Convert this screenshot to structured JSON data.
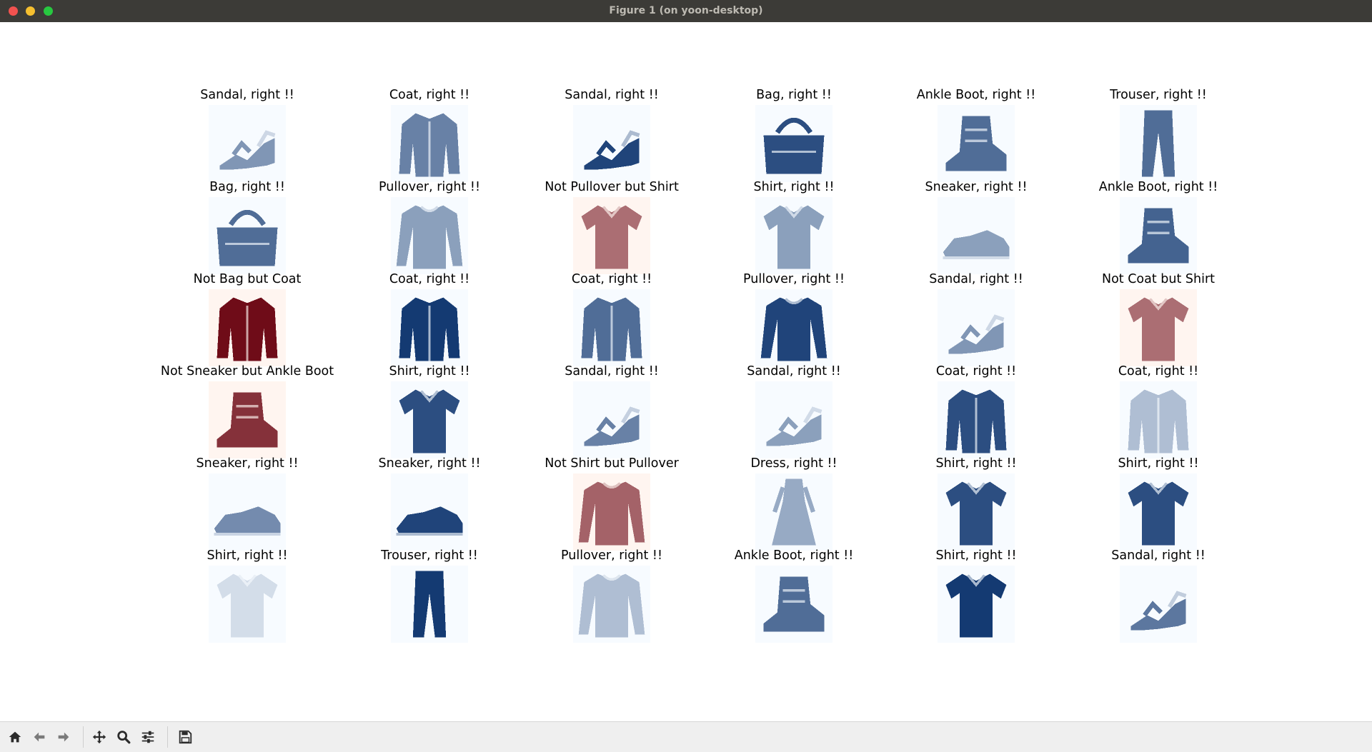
{
  "window": {
    "title": "Figure 1 (on yoon-desktop)"
  },
  "colors": {
    "correct_cmap": "Blues",
    "wrong_cmap": "Reds",
    "titlebar": "#3c3b37",
    "toolbar": "#efefef"
  },
  "grid": {
    "rows": 6,
    "cols": 6,
    "cells": [
      {
        "title": "Sandal, right !!",
        "item": "Sandal",
        "correct": true,
        "intensity": 0.5
      },
      {
        "title": "Coat, right !!",
        "item": "Coat",
        "correct": true,
        "intensity": 0.6
      },
      {
        "title": "Sandal, right !!",
        "item": "Sandal",
        "correct": true,
        "intensity": 0.9
      },
      {
        "title": "Bag, right !!",
        "item": "Bag",
        "correct": true,
        "intensity": 0.85
      },
      {
        "title": "Ankle Boot, right !!",
        "item": "Ankle Boot",
        "correct": true,
        "intensity": 0.7
      },
      {
        "title": "Trouser, right !!",
        "item": "Trouser",
        "correct": true,
        "intensity": 0.7
      },
      {
        "title": "Bag, right !!",
        "item": "Bag",
        "correct": true,
        "intensity": 0.7
      },
      {
        "title": "Pullover, right !!",
        "item": "Pullover",
        "correct": true,
        "intensity": 0.45
      },
      {
        "title": "Not Pullover but Shirt",
        "item": "Shirt",
        "correct": false,
        "intensity": 0.55
      },
      {
        "title": "Shirt, right !!",
        "item": "Shirt",
        "correct": true,
        "intensity": 0.45
      },
      {
        "title": "Sneaker, right !!",
        "item": "Sneaker",
        "correct": true,
        "intensity": 0.45
      },
      {
        "title": "Ankle Boot, right !!",
        "item": "Ankle Boot",
        "correct": true,
        "intensity": 0.75
      },
      {
        "title": "Not Bag but Coat",
        "item": "Coat",
        "correct": false,
        "intensity": 0.95
      },
      {
        "title": "Coat, right !!",
        "item": "Coat",
        "correct": true,
        "intensity": 0.95
      },
      {
        "title": "Coat, right !!",
        "item": "Coat",
        "correct": true,
        "intensity": 0.7
      },
      {
        "title": "Pullover, right !!",
        "item": "Pullover",
        "correct": true,
        "intensity": 0.9
      },
      {
        "title": "Sandal, right !!",
        "item": "Sandal",
        "correct": true,
        "intensity": 0.5
      },
      {
        "title": "Not Coat but Shirt",
        "item": "Shirt",
        "correct": false,
        "intensity": 0.55
      },
      {
        "title": "Not Sneaker but Ankle Boot",
        "item": "Ankle Boot",
        "correct": false,
        "intensity": 0.8
      },
      {
        "title": "Shirt, right !!",
        "item": "Shirt",
        "correct": true,
        "intensity": 0.85
      },
      {
        "title": "Sandal, right !!",
        "item": "Sandal",
        "correct": true,
        "intensity": 0.6
      },
      {
        "title": "Sandal, right !!",
        "item": "Sandal",
        "correct": true,
        "intensity": 0.45
      },
      {
        "title": "Coat, right !!",
        "item": "Coat",
        "correct": true,
        "intensity": 0.85
      },
      {
        "title": "Coat, right !!",
        "item": "Coat",
        "correct": true,
        "intensity": 0.3
      },
      {
        "title": "Sneaker, right !!",
        "item": "Sneaker",
        "correct": true,
        "intensity": 0.55
      },
      {
        "title": "Sneaker, right !!",
        "item": "Sneaker",
        "correct": true,
        "intensity": 0.9
      },
      {
        "title": "Not Shirt but Pullover",
        "item": "Pullover",
        "correct": false,
        "intensity": 0.6
      },
      {
        "title": "Dress, right !!",
        "item": "Dress",
        "correct": true,
        "intensity": 0.4
      },
      {
        "title": "Shirt, right !!",
        "item": "Shirt",
        "correct": true,
        "intensity": 0.85
      },
      {
        "title": "Shirt, right !!",
        "item": "Shirt",
        "correct": true,
        "intensity": 0.85
      },
      {
        "title": "Shirt, right !!",
        "item": "Shirt",
        "correct": true,
        "intensity": 0.15
      },
      {
        "title": "Trouser, right !!",
        "item": "Trouser",
        "correct": true,
        "intensity": 0.95
      },
      {
        "title": "Pullover, right !!",
        "item": "Pullover",
        "correct": true,
        "intensity": 0.3
      },
      {
        "title": "Ankle Boot, right !!",
        "item": "Ankle Boot",
        "correct": true,
        "intensity": 0.7
      },
      {
        "title": "Shirt, right !!",
        "item": "Shirt",
        "correct": true,
        "intensity": 0.95
      },
      {
        "title": "Sandal, right !!",
        "item": "Sandal",
        "correct": true,
        "intensity": 0.65
      }
    ]
  },
  "toolbar": {
    "buttons": [
      {
        "name": "home-button",
        "icon": "home-icon"
      },
      {
        "name": "back-button",
        "icon": "arrow-left-icon"
      },
      {
        "name": "forward-button",
        "icon": "arrow-right-icon"
      },
      {
        "name": "pan-button",
        "icon": "move-icon"
      },
      {
        "name": "zoom-button",
        "icon": "magnifier-icon"
      },
      {
        "name": "configure-subplots-button",
        "icon": "sliders-icon"
      },
      {
        "name": "save-button",
        "icon": "floppy-disk-icon"
      }
    ]
  }
}
